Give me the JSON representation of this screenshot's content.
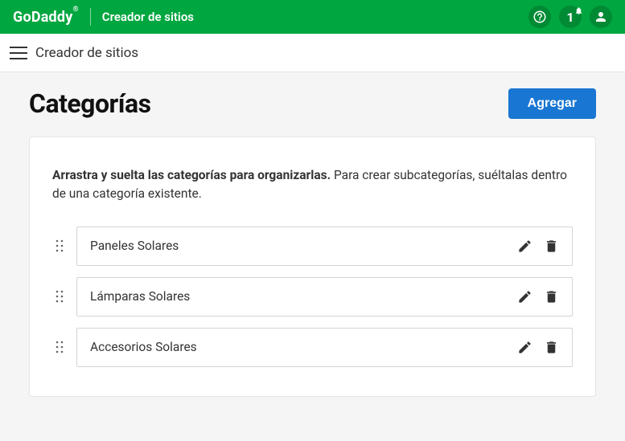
{
  "topbar": {
    "brand": "GoDaddy",
    "brandSub": "Creador de sitios",
    "notificationCount": "1"
  },
  "subbar": {
    "title": "Creador de sitios"
  },
  "page": {
    "title": "Categorías",
    "addButton": "Agregar"
  },
  "instructions": {
    "bold": "Arrastra y suelta las categorías para organizarlas.",
    "rest": " Para crear subcategorías, suéltalas dentro de una categoría existente."
  },
  "categories": [
    {
      "name": "Paneles Solares"
    },
    {
      "name": "Lámparas Solares"
    },
    {
      "name": "Accesorios Solares"
    }
  ]
}
